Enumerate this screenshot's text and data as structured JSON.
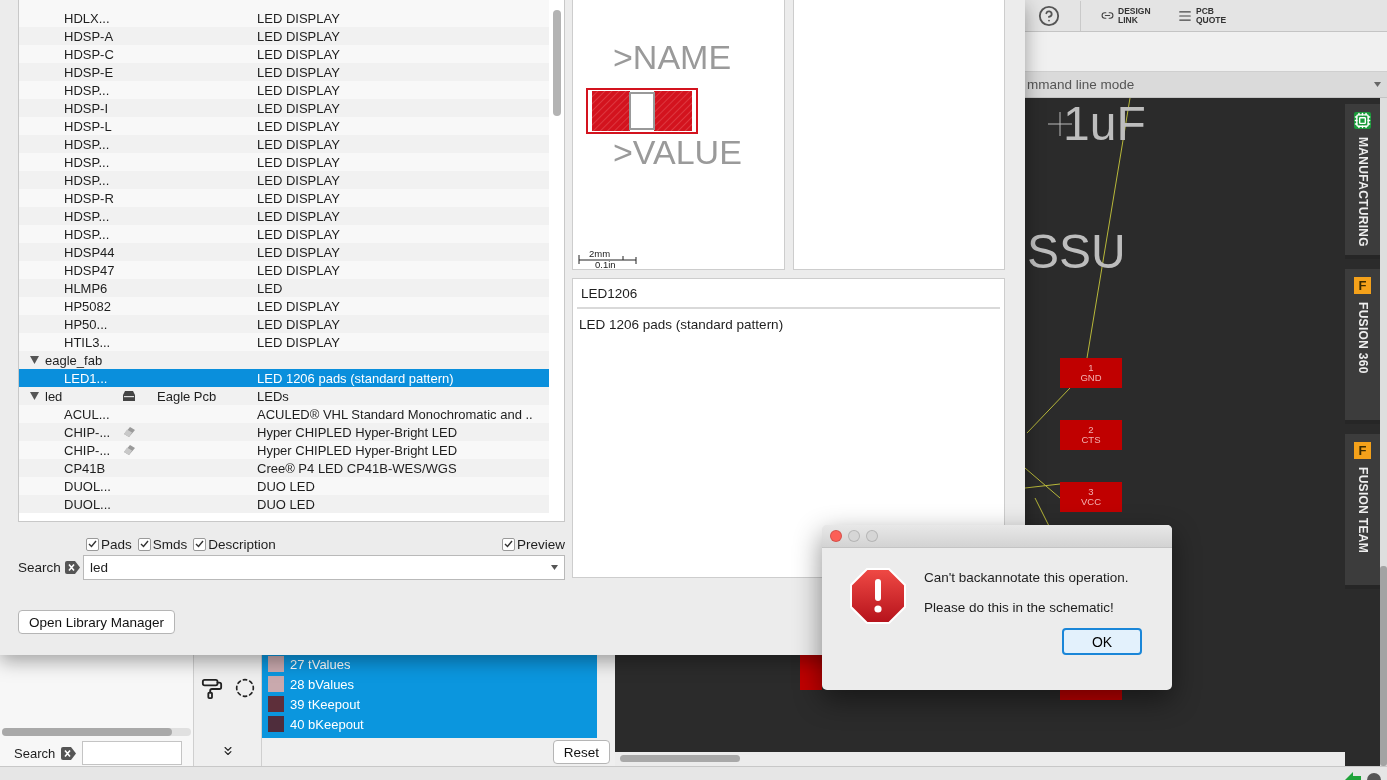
{
  "library_window": {
    "tree": [
      {
        "children": [
          {
            "name": "HDLX...",
            "description": "LED DISPLAY",
            "selected": false
          },
          {
            "name": "HDSP-A",
            "description": "LED DISPLAY",
            "selected": false
          },
          {
            "name": "HDSP-C",
            "description": "LED DISPLAY",
            "selected": false
          },
          {
            "name": "HDSP-E",
            "description": "LED DISPLAY",
            "selected": false
          },
          {
            "name": "HDSP...",
            "description": "LED DISPLAY",
            "selected": false
          },
          {
            "name": "HDSP-I",
            "description": "LED DISPLAY",
            "selected": false
          },
          {
            "name": "HDSP-L",
            "description": "LED DISPLAY",
            "selected": false
          },
          {
            "name": "HDSP...",
            "description": "LED DISPLAY",
            "selected": false
          },
          {
            "name": "HDSP...",
            "description": "LED DISPLAY",
            "selected": false
          },
          {
            "name": "HDSP...",
            "description": "LED DISPLAY",
            "selected": false
          },
          {
            "name": "HDSP-R",
            "description": "LED DISPLAY",
            "selected": false
          },
          {
            "name": "HDSP...",
            "description": "LED DISPLAY",
            "selected": false
          },
          {
            "name": "HDSP...",
            "description": "LED DISPLAY",
            "selected": false
          },
          {
            "name": "HDSP44",
            "description": "LED DISPLAY",
            "selected": false
          },
          {
            "name": "HDSP47",
            "description": "LED DISPLAY",
            "selected": false
          },
          {
            "name": "HLMP6",
            "description": "LED",
            "selected": false
          },
          {
            "name": "HP5082",
            "description": "LED DISPLAY",
            "selected": false
          },
          {
            "name": "HP50...",
            "description": "LED DISPLAY",
            "selected": false
          },
          {
            "name": "HTIL3...",
            "description": "LED DISPLAY",
            "selected": false
          }
        ]
      },
      {
        "name": "eagle_fab",
        "kind": "group",
        "expanded": true,
        "selected": false,
        "children": [
          {
            "name": "LED1...",
            "description": "LED 1206 pads (standard pattern)",
            "selected": true
          }
        ]
      },
      {
        "name": "led",
        "kind": "library",
        "expanded": true,
        "selected": false,
        "source": "Eagle Pcb",
        "description": "LEDs",
        "children": [
          {
            "name": "ACUL...",
            "description": "ACULED® VHL Standard Monochromatic and ..",
            "selected": false
          },
          {
            "name": "CHIP-...",
            "kind": "eraser",
            "description": "Hyper CHIPLED Hyper-Bright LED",
            "selected": false
          },
          {
            "name": "CHIP-...",
            "kind": "eraser",
            "description": "Hyper CHIPLED Hyper-Bright LED",
            "selected": false
          },
          {
            "name": "CP41B",
            "description": "Cree® P4 LED CP41B-WES/WGS",
            "selected": false
          },
          {
            "name": "DUOL...",
            "description": "DUO LED",
            "selected": false
          },
          {
            "name": "DUOL...",
            "description": "DUO LED",
            "selected": false
          }
        ]
      }
    ],
    "filters": [
      {
        "label": "Pads",
        "checked": true
      },
      {
        "label": "Smds",
        "checked": true
      },
      {
        "label": "Description",
        "checked": true
      }
    ],
    "preview_option": {
      "label": "Preview",
      "checked": true
    },
    "search": {
      "label": "Search",
      "value": "led"
    },
    "button": "Open Library Manager",
    "preview": {
      "name_label": ">NAME",
      "value_label": ">VALUE",
      "scale_metric": "2mm",
      "scale_imperial": "0.1in"
    },
    "details": {
      "title": "LED1206",
      "description": "LED 1206 pads (standard pattern)"
    }
  },
  "board_editor": {
    "toolbar": [
      {
        "label": "DESIGN LINK",
        "kind": "link"
      },
      {
        "label": "PCB QUOTE",
        "kind": "quote"
      }
    ],
    "command_line": {
      "placeholder": "mmand line mode"
    },
    "canvas": {
      "labels": [
        "1uF",
        "SSU"
      ],
      "pads": [
        {
          "number": "1",
          "signal": "GND"
        },
        {
          "number": "2",
          "signal": "CTS"
        },
        {
          "number": "3",
          "signal": "VCC"
        }
      ]
    },
    "side_tabs": [
      {
        "label": "MANUFACTURING",
        "kind": "manufacturing"
      },
      {
        "label": "FUSION 360",
        "kind": "fusion",
        "logo": "F"
      },
      {
        "label": "FUSION TEAM",
        "kind": "fusion",
        "logo": "F"
      }
    ],
    "layers": [
      {
        "label": "27 tValues",
        "color": "#c9a9ad",
        "selected": true
      },
      {
        "label": "28 bValues",
        "color": "#c9a9ad",
        "selected": true
      },
      {
        "label": "39 tKeepout",
        "color": "#5e2f3a",
        "selected": true
      },
      {
        "label": "40 bKeepout",
        "color": "#4f2d3c",
        "selected": true
      }
    ],
    "reset_button": "Reset",
    "search": {
      "label": "Search"
    }
  },
  "alert": {
    "message": "Can't backannotate this operation.",
    "detail": "Please do this in the schematic!",
    "button": "OK"
  }
}
